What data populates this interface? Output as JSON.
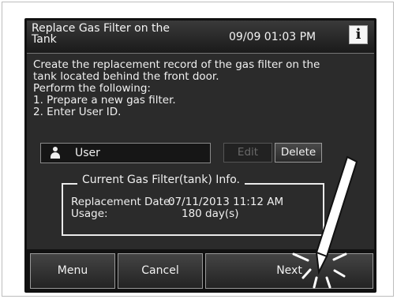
{
  "header": {
    "title": "Replace Gas Filter on the Tank",
    "datetime": "09/09 01:03 PM",
    "info_icon": "i"
  },
  "instructions": [
    "Create the replacement record of the gas filter on the",
    "tank located behind the front door.",
    "Perform the following:",
    "1. Prepare a new gas filter.",
    "2. Enter User ID."
  ],
  "user": {
    "icon": "user-icon",
    "value": "User",
    "edit_label": "Edit",
    "delete_label": "Delete"
  },
  "filter_info": {
    "title": "Current Gas Filter(tank) Info.",
    "replacement_date_label": "Replacement Date:",
    "replacement_date_value": "07/11/2013 11:12 AM",
    "usage_label": "Usage:",
    "usage_value": "180 day(s)"
  },
  "nav": {
    "menu_label": "Menu",
    "cancel_label": "Cancel",
    "next_label": "Next"
  },
  "colors": {
    "screen_bg": "#2b2b2b",
    "text": "#f2f2f2",
    "disabled_text": "#6a6a6a"
  }
}
